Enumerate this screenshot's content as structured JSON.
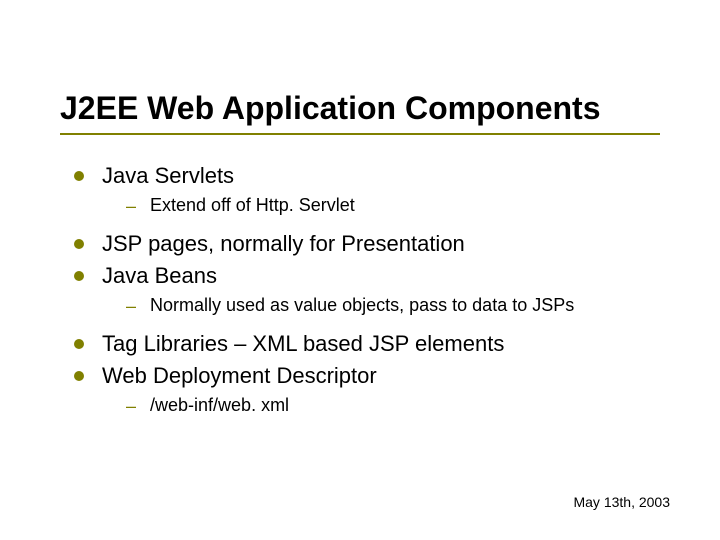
{
  "title": "J2EE Web Application Components",
  "items": {
    "b1": "Java Servlets",
    "b1_sub": "Extend off of Http. Servlet",
    "b2": "JSP pages, normally for Presentation",
    "b3": "Java Beans",
    "b3_sub": "Normally used as value objects, pass to data to JSPs",
    "b4": "Tag Libraries – XML based JSP elements",
    "b5": "Web Deployment Descriptor",
    "b5_sub": "/web-inf/web. xml"
  },
  "footer": "May 13th, 2003"
}
